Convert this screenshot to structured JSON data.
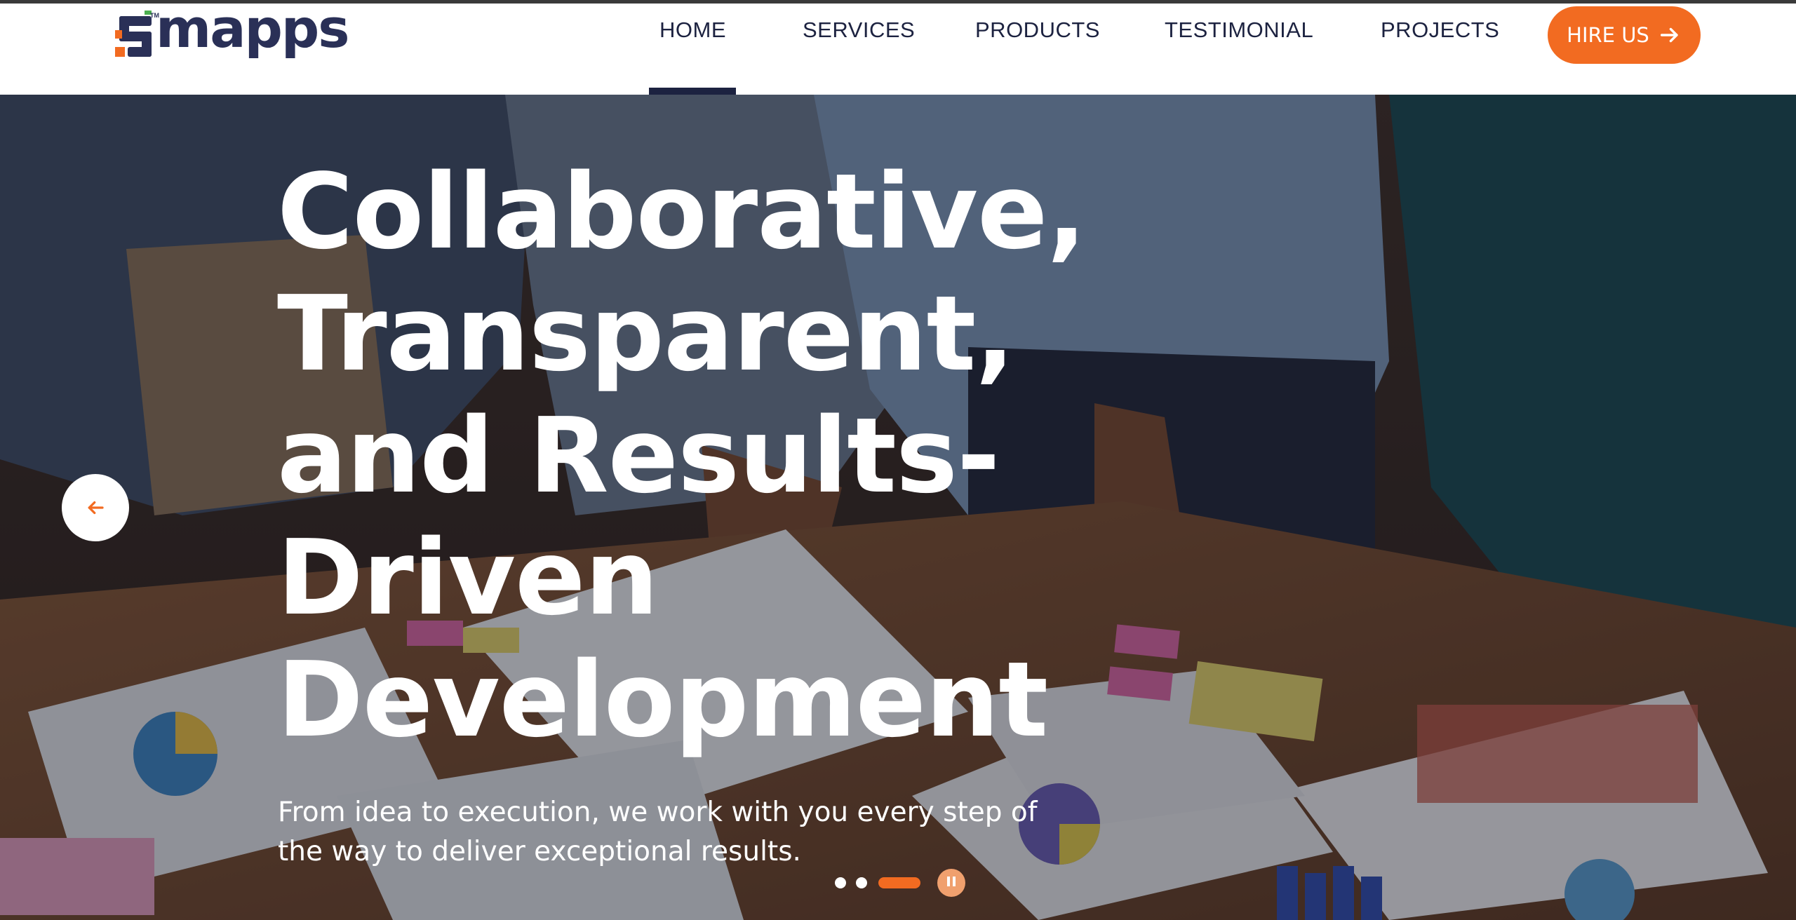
{
  "brand": {
    "name": "mapps",
    "trademark": "TM",
    "colors": {
      "primary": "#2a3057",
      "accent": "#f26b21"
    }
  },
  "nav": {
    "items": [
      {
        "label": "HOME",
        "active": true
      },
      {
        "label": "SERVICES",
        "active": false
      },
      {
        "label": "PRODUCTS",
        "active": false
      },
      {
        "label": "TESTIMONIAL",
        "active": false
      },
      {
        "label": "PROJECTS",
        "active": false
      }
    ],
    "cta_label": "HIRE US",
    "cta_icon": "arrow-right-icon"
  },
  "hero": {
    "title_lines": [
      "Collaborative,",
      "Transparent,",
      "and Results-",
      "Driven",
      "Development"
    ],
    "subtitle": "From idea to execution, we work with you every step of the way to deliver exceptional results.",
    "prev_icon": "arrow-left-icon",
    "slider": {
      "slide_count": 3,
      "active_index": 2,
      "pause_icon": "pause-icon"
    }
  }
}
